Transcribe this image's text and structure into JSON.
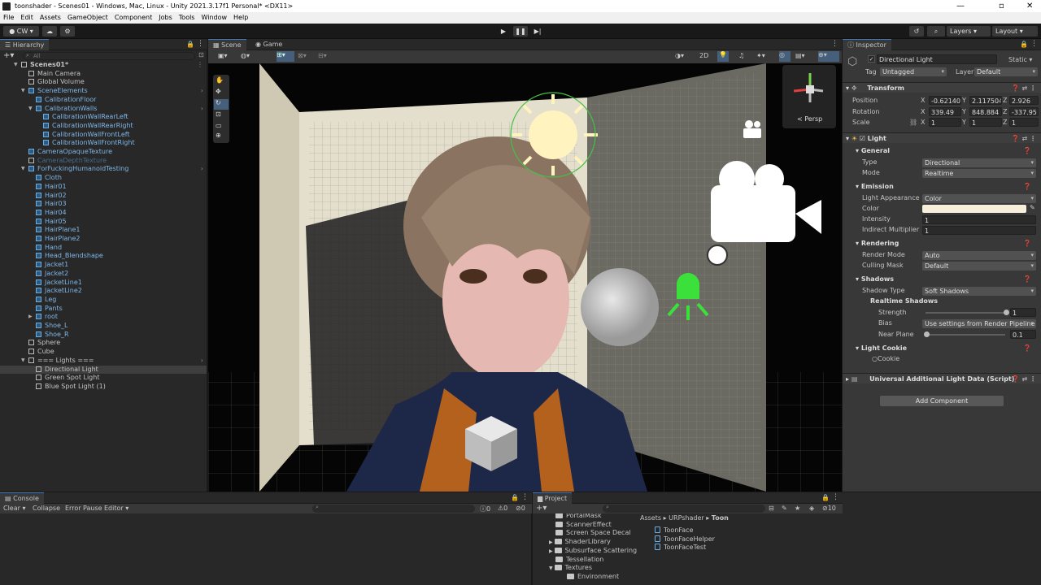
{
  "window": {
    "title": "toonshader - Scenes01 - Windows, Mac, Linux - Unity 2021.3.17f1 Personal* <DX11>"
  },
  "menu": [
    "File",
    "Edit",
    "Assets",
    "GameObject",
    "Component",
    "Jobs",
    "Tools",
    "Window",
    "Help"
  ],
  "toolbar": {
    "account": "CW",
    "layers": "Layers",
    "layout": "Layout"
  },
  "hierarchy": {
    "title": "Hierarchy",
    "search_placeholder": "All",
    "items": [
      {
        "label": "Scenes01*",
        "depth": 0,
        "type": "scene",
        "arrow": true
      },
      {
        "label": "Main Camera",
        "depth": 1
      },
      {
        "label": "Global Volume",
        "depth": 1
      },
      {
        "label": "SceneElements",
        "depth": 1,
        "blue": true,
        "arrow": true
      },
      {
        "label": "CalibrationFloor",
        "depth": 2,
        "blue": true
      },
      {
        "label": "CalibrationWalls",
        "depth": 2,
        "blue": true,
        "arrow": true
      },
      {
        "label": "CalibrationWallRearLeft",
        "depth": 3,
        "blue": true
      },
      {
        "label": "CalibrationWallRearRight",
        "depth": 3,
        "blue": true
      },
      {
        "label": "CalibrationWallFrontLeft",
        "depth": 3,
        "blue": true
      },
      {
        "label": "CalibrationWallFrontRight",
        "depth": 3,
        "blue": true
      },
      {
        "label": "CameraOpaqueTexture",
        "depth": 1,
        "blue": true
      },
      {
        "label": "CameraDepthTexture",
        "depth": 1,
        "dim": true
      },
      {
        "label": "ForFuckingHumanoidTesting",
        "depth": 1,
        "blue": true,
        "arrow": true
      },
      {
        "label": "Cloth",
        "depth": 2,
        "blue": true
      },
      {
        "label": "Hair01",
        "depth": 2,
        "blue": true
      },
      {
        "label": "Hair02",
        "depth": 2,
        "blue": true
      },
      {
        "label": "Hair03",
        "depth": 2,
        "blue": true
      },
      {
        "label": "Hair04",
        "depth": 2,
        "blue": true
      },
      {
        "label": "Hair05",
        "depth": 2,
        "blue": true
      },
      {
        "label": "HairPlane1",
        "depth": 2,
        "blue": true
      },
      {
        "label": "HairPlane2",
        "depth": 2,
        "blue": true
      },
      {
        "label": "Hand",
        "depth": 2,
        "blue": true
      },
      {
        "label": "Head_Blendshape",
        "depth": 2,
        "blue": true
      },
      {
        "label": "Jacket1",
        "depth": 2,
        "blue": true
      },
      {
        "label": "Jacket2",
        "depth": 2,
        "blue": true
      },
      {
        "label": "JacketLine1",
        "depth": 2,
        "blue": true
      },
      {
        "label": "JacketLine2",
        "depth": 2,
        "blue": true
      },
      {
        "label": "Leg",
        "depth": 2,
        "blue": true
      },
      {
        "label": "Pants",
        "depth": 2,
        "blue": true
      },
      {
        "label": "root",
        "depth": 2,
        "blue": true,
        "collapsed": true
      },
      {
        "label": "Shoe_L",
        "depth": 2,
        "blue": true
      },
      {
        "label": "Shoe_R",
        "depth": 2,
        "blue": true
      },
      {
        "label": "Sphere",
        "depth": 1
      },
      {
        "label": "Cube",
        "depth": 1
      },
      {
        "label": "=== Lights ===",
        "depth": 1,
        "arrow": true
      },
      {
        "label": "Directional Light",
        "depth": 2,
        "selected": true
      },
      {
        "label": "Green Spot Light",
        "depth": 2
      },
      {
        "label": "Blue Spot Light (1)",
        "depth": 2
      }
    ]
  },
  "scene": {
    "tab_scene": "Scene",
    "tab_game": "Game",
    "mode_2d": "2D",
    "persp": "< Persp"
  },
  "inspector": {
    "title": "Inspector",
    "object_name": "Directional Light",
    "static_label": "Static",
    "tag_label": "Tag",
    "tag_value": "Untagged",
    "layer_label": "Layer",
    "layer_value": "Default",
    "transform": {
      "title": "Transform",
      "position_label": "Position",
      "position": [
        "-0.62140",
        "2.117504",
        "2.926"
      ],
      "rotation_label": "Rotation",
      "rotation": [
        "339.49",
        "848.884",
        "-337.95"
      ],
      "scale_label": "Scale",
      "scale": [
        "1",
        "1",
        "1"
      ]
    },
    "light": {
      "title": "Light",
      "general": "General",
      "type_label": "Type",
      "type_value": "Directional",
      "mode_label": "Mode",
      "mode_value": "Realtime",
      "emission": "Emission",
      "appearance_label": "Light Appearance",
      "appearance_value": "Color",
      "color_label": "Color",
      "color_hex": "#f7efdc",
      "intensity_label": "Intensity",
      "intensity_value": "1",
      "indirect_label": "Indirect Multiplier",
      "indirect_value": "1",
      "rendering": "Rendering",
      "render_mode_label": "Render Mode",
      "render_mode_value": "Auto",
      "culling_label": "Culling Mask",
      "culling_value": "Default",
      "shadows": "Shadows",
      "shadow_type_label": "Shadow Type",
      "shadow_type_value": "Soft Shadows",
      "realtime_shadows": "Realtime Shadows",
      "strength_label": "Strength",
      "strength_value": "1",
      "bias_label": "Bias",
      "bias_value": "Use settings from Render Pipeline",
      "near_plane_label": "Near Plane",
      "near_plane_value": "0.1",
      "cookie_title": "Light Cookie",
      "cookie_label": "Cookie"
    },
    "urp": {
      "title": "Universal Additional Light Data (Script)"
    },
    "add_component": "Add Component"
  },
  "console": {
    "title": "Console",
    "clear": "Clear",
    "collapse": "Collapse",
    "error_pause": "Error Pause",
    "editor": "Editor",
    "count_log": "0",
    "count_warn": "0",
    "count_err": "0"
  },
  "project": {
    "title": "Project",
    "badge": "10",
    "breadcrumb": [
      "Assets",
      "URPshader",
      "Toon"
    ],
    "tree": [
      "PortalMask",
      "ScannerEffect",
      "Screen Space Decal",
      "ShaderLibrary",
      "Subsurface Scattering",
      "Tessellation",
      "Textures",
      "Environment"
    ],
    "files": [
      "ToonFace",
      "ToonFaceHelper",
      "ToonFaceTest"
    ]
  }
}
